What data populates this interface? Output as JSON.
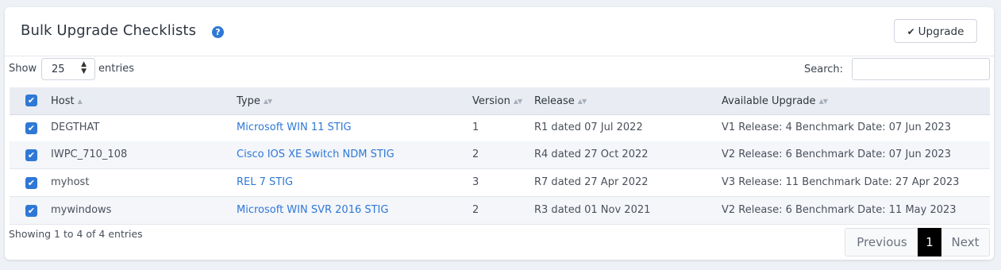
{
  "header": {
    "title": "Bulk Upgrade Checklists",
    "help_icon": "?",
    "upgrade_check": "✔",
    "upgrade_label": "Upgrade"
  },
  "controls": {
    "show_label": "Show",
    "entries_value": "25",
    "entries_label": "entries",
    "search_label": "Search:",
    "search_value": ""
  },
  "table": {
    "columns": [
      "Host",
      "Type",
      "Version",
      "Release",
      "Available Upgrade"
    ],
    "rows": [
      {
        "host": "DEGTHAT",
        "type": "Microsoft WIN 11 STIG",
        "version": "1",
        "release": "R1 dated 07 Jul 2022",
        "upgrade": "V1 Release: 4 Benchmark Date: 07 Jun 2023",
        "checked": true
      },
      {
        "host": "IWPC_710_108",
        "type": "Cisco IOS XE Switch NDM STIG",
        "version": "2",
        "release": "R4 dated 27 Oct 2022",
        "upgrade": "V2 Release: 6 Benchmark Date: 07 Jun 2023",
        "checked": true
      },
      {
        "host": "myhost",
        "type": "REL 7 STIG",
        "version": "3",
        "release": "R7 dated 27 Apr 2022",
        "upgrade": "V3 Release: 11 Benchmark Date: 27 Apr 2023",
        "checked": true
      },
      {
        "host": "mywindows",
        "type": "Microsoft WIN SVR 2016 STIG",
        "version": "2",
        "release": "R3 dated 01 Nov 2021",
        "upgrade": "V2 Release: 6 Benchmark Date: 11 May 2023",
        "checked": true
      }
    ]
  },
  "footer": {
    "info": "Showing 1 to 4 of 4 entries",
    "previous": "Previous",
    "page": "1",
    "next": "Next"
  },
  "colors": {
    "accent": "#2f78d6",
    "active_page": "#000000"
  },
  "icons": {
    "help": "question-circle-icon",
    "upgrade": "check-icon",
    "sort": "sort-icon",
    "checkbox": "checkbox-checked-icon"
  }
}
